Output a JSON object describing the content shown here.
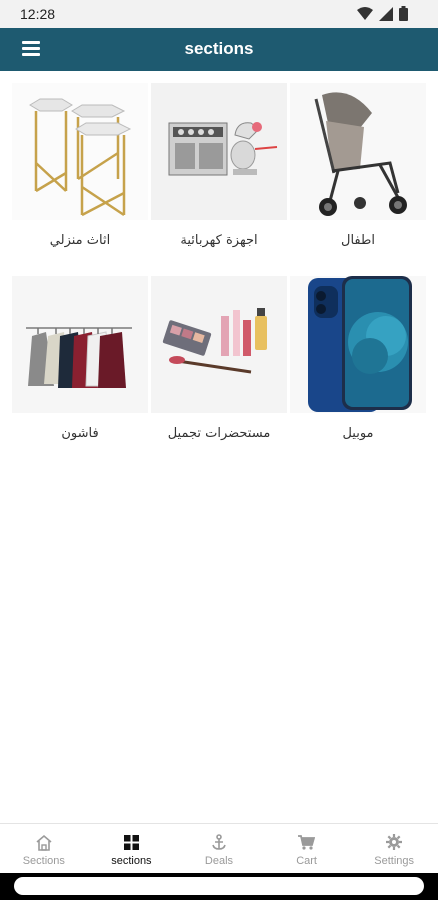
{
  "status_bar": {
    "time": "12:28",
    "icons": [
      "wifi-icon",
      "signal-icon",
      "battery-icon"
    ]
  },
  "app_bar": {
    "title": "sections",
    "menu_icon": "hamburger-menu-icon",
    "color": "#1e5a70"
  },
  "sections": [
    {
      "label": "اطفال",
      "icon": "stroller-image"
    },
    {
      "label": "اجهزة كهربائية",
      "icon": "appliances-image"
    },
    {
      "label": "اثاث منزلي",
      "icon": "furniture-tables-image"
    },
    {
      "label": "موبيل",
      "icon": "mobile-phone-image"
    },
    {
      "label": "مستحضرات تجميل",
      "icon": "cosmetics-image"
    },
    {
      "label": "فاشون",
      "icon": "clothes-rack-image"
    }
  ],
  "bottom_nav": {
    "items": [
      {
        "label": "Sections",
        "icon": "home-icon",
        "active": false
      },
      {
        "label": "sections",
        "icon": "grid-icon",
        "active": true
      },
      {
        "label": "Deals",
        "icon": "anchor-icon",
        "active": false
      },
      {
        "label": "Cart",
        "icon": "cart-icon",
        "active": false
      },
      {
        "label": "Settings",
        "icon": "gear-icon",
        "active": false
      }
    ]
  }
}
